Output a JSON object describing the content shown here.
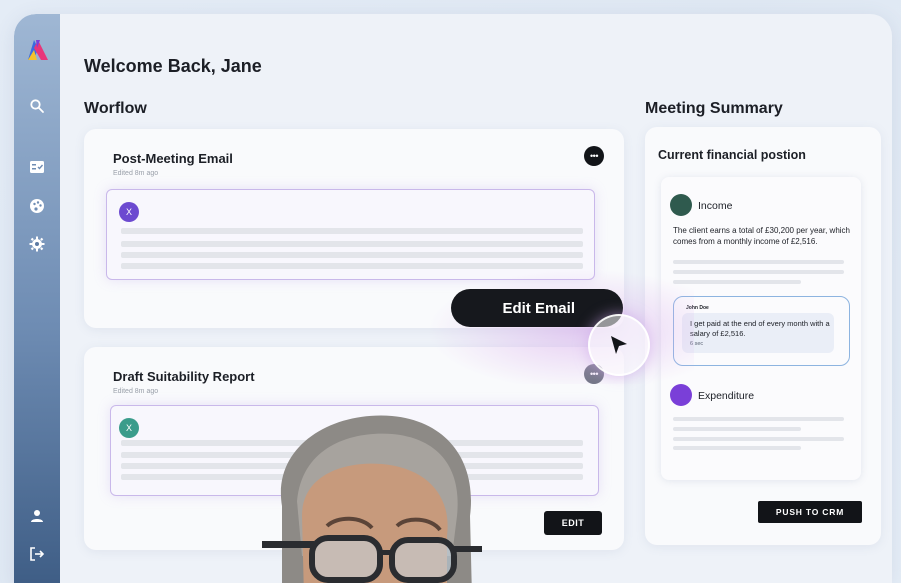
{
  "greeting": "Welcome Back, Jane",
  "workflow": {
    "title": "Worflow",
    "cards": [
      {
        "title": "Post-Meeting Email",
        "subtitle": "Edited 8m ago",
        "avatar": "X",
        "avatar_color": "#6c4ad0"
      },
      {
        "title": "Draft Suitability Report",
        "subtitle": "Edited 8m ago",
        "avatar": "X",
        "avatar_color": "#3a9c8b"
      }
    ],
    "edit_email_label": "Edit Email",
    "edit_label": "EDIT",
    "more_glyph": "•••"
  },
  "summary": {
    "title": "Meeting Summary",
    "card_title": "Current financial postion",
    "income": {
      "label": "Income",
      "color": "#2f5a4e",
      "text": "The client earns a total of £30,200 per year, which comes from a monthly income of £2,516."
    },
    "chat": {
      "name": "John Doe",
      "message": "I get paid at the end of every month with a salary of £2,516.",
      "time": "6 sec"
    },
    "expenditure": {
      "label": "Expenditure",
      "color": "#7a3fd8"
    },
    "push_label": "PUSH TO CRM"
  },
  "sidebar_icons": [
    "search-icon",
    "checklist-icon",
    "palette-icon",
    "gear-icon",
    "user-icon",
    "logout-icon"
  ],
  "colors": {
    "accent_dark": "#121418",
    "box_border": "#c9b8ea",
    "chat_border": "#8db4e0"
  }
}
